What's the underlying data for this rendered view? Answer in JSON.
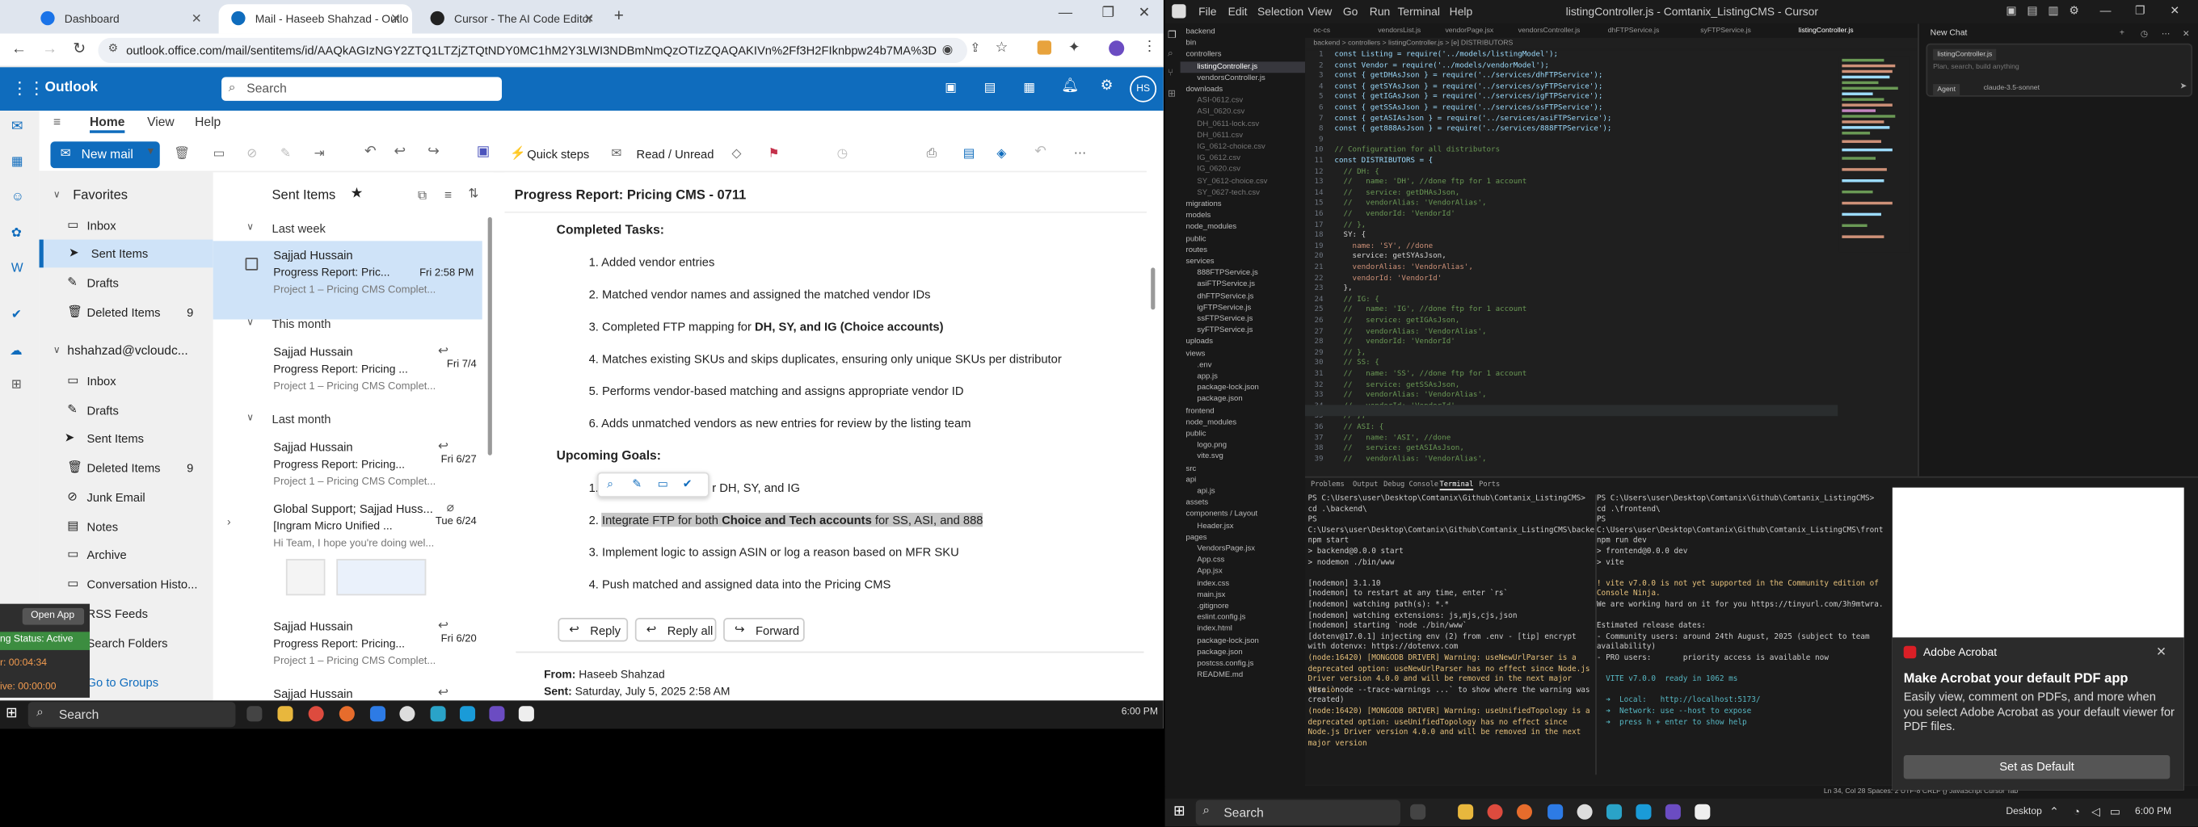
{
  "browser": {
    "tabs": [
      {
        "label": "Dashboard"
      },
      {
        "label": "Mail - Haseeb Shahzad - Outlo"
      },
      {
        "label": "Cursor - The AI Code Editor"
      }
    ],
    "url": "outlook.office.com/mail/sentitems/id/AAQkAGIzNGY2ZTQ1LTZjZTQtNDY0MC1hM2Y3LWI3NDBmNmQzOTIzZQAQAKIVn%2Ff3H2FIknbpw24b7MA%3D"
  },
  "outlook": {
    "app_name": "Outlook",
    "search_placeholder": "Search",
    "avatar": "HS",
    "ribbon_tabs": [
      "Home",
      "View",
      "Help"
    ],
    "new_mail": "New mail",
    "quick_steps": "Quick steps",
    "read_unread": "Read / Unread",
    "nav": {
      "favorites": "Favorites",
      "account": "hshahzad@vcloudc...",
      "inbox": "Inbox",
      "sent": "Sent Items",
      "drafts": "Drafts",
      "deleted": "Deleted Items",
      "deleted_count": "9",
      "junk": "Junk Email",
      "notes": "Notes",
      "archive": "Archive",
      "conversation": "Conversation Histo...",
      "rss": "RSS Feeds",
      "search_folders": "Search Folders",
      "go_groups": "Go to Groups",
      "inbox2": "Inbox",
      "drafts2": "Drafts",
      "sent2": "Sent Items",
      "deleted2": "Deleted Items",
      "deleted_count2": "9"
    },
    "list_title": "Sent Items",
    "groups": [
      "Last week",
      "This month",
      "Last month"
    ],
    "messages": [
      {
        "from": "Sajjad Hussain",
        "subject": "Progress Report: Pric...",
        "date": "Fri 2:58 PM",
        "preview": "Project 1 – Pricing CMS Complet..."
      },
      {
        "from": "Sajjad Hussain",
        "subject": "Progress Report: Pricing ...",
        "date": "Fri 7/4",
        "preview": "Project 1 – Pricing CMS Complet..."
      },
      {
        "from": "Sajjad Hussain",
        "subject": "Progress Report: Pricing...",
        "date": "Fri 6/27",
        "preview": "Project 1 – Pricing CMS Complet..."
      },
      {
        "from": "Global Support; Sajjad Huss...",
        "subject": "[Ingram Micro Unified ...",
        "date": "Tue 6/24",
        "preview": "Hi Team, I hope you're doing wel..."
      },
      {
        "from": "Sajjad Hussain",
        "subject": "Progress Report: Pricing...",
        "date": "Fri 6/20",
        "preview": "Project 1 – Pricing CMS Complet..."
      },
      {
        "from": "Sajjad Hussain",
        "subject": "",
        "date": "",
        "preview": ""
      }
    ],
    "reading": {
      "subject": "Progress Report: Pricing CMS - 0711",
      "completed_heading": "Completed Tasks:",
      "completed": [
        "1. Added vendor entries",
        "2. Matched vendor names and assigned the matched vendor IDs",
        "3. Completed FTP mapping for ",
        "4. Matches existing SKUs and skips duplicates, ensuring only unique SKUs per distributor",
        "5. Performs vendor-based matching and assigns appropriate vendor ID",
        "6. Adds unmatched vendors as new entries for review by the listing team"
      ],
      "ftp_bold": "DH, SY, and IG (Choice accounts)",
      "upcoming_heading": "Upcoming Goals:",
      "upcoming1": "1. In",
      "upcoming1_tail": "r DH, SY, and IG",
      "upcoming2_a": "2. ",
      "upcoming2_b": "Integrate FTP for both ",
      "upcoming2_c": "Choice and Tech accounts",
      "upcoming2_d": " for SS, ASI, and 888",
      "upcoming3": "3. Implement logic to assign ASIN or log a reason based on MFR SKU",
      "upcoming4": "4. Push matched and assigned data into the Pricing CMS",
      "reply": "Reply",
      "reply_all": "Reply all",
      "forward": "Forward",
      "from_label": "From: ",
      "from_value": "Haseeb Shahzad",
      "sent_label": "Sent: ",
      "sent_value": "Saturday, July 5, 2025 2:58 AM"
    },
    "overlay": {
      "open_app": "Open App",
      "status": "ng Status: Active",
      "time1": "r: 00:04:34",
      "time2": "ive: 00:00:00"
    }
  },
  "taskbar_left": {
    "search": "Search",
    "time": "6:00 PM"
  },
  "cursor": {
    "title": "listingController.js - Comtanix_ListingCMS - Cursor",
    "menu": [
      "File",
      "Edit",
      "Selection",
      "View",
      "Go",
      "Run",
      "Terminal",
      "Help"
    ],
    "breadcrumb": "backend > controllers > listingController.js > [e] DISTRIBUTORS",
    "tabs": [
      "oc-cs",
      "vendorsList.js",
      "vendorPage.jsx",
      "vendorsController.js",
      "dhFTPService.js",
      "syFTPService.js",
      "listingController.js"
    ],
    "tree": [
      "backend",
      "bin",
      "controllers",
      "listingController.js",
      "vendorsController.js",
      "downloads",
      "ASI-0612.csv",
      "ASI_0620.csv",
      "DH_0611-lock.csv",
      "DH_0611.csv",
      "IG_0612-choice.csv",
      "IG_0612.csv",
      "IG_0620.csv",
      "SY_0612-choice.csv",
      "SY_0627-tech.csv",
      "migrations",
      "models",
      "node_modules",
      "public",
      "routes",
      "services",
      "888FTPService.js",
      "asiFTPService.js",
      "dhFTPService.js",
      "igFTPService.js",
      "ssFTPService.js",
      "syFTPService.js",
      "uploads",
      "views",
      ".env",
      "app.js",
      "package-lock.json",
      "package.json",
      "frontend",
      "node_modules",
      "public",
      "logo.png",
      "vite.svg",
      "src",
      "api",
      "api.js",
      "assets",
      "components / Layout",
      "Header.jsx",
      "pages",
      "VendorsPage.jsx",
      "App.css",
      "App.jsx",
      "index.css",
      "main.jsx",
      ".gitignore",
      "eslint.config.js",
      "index.html",
      "package-lock.json",
      "package.json",
      "postcss.config.js",
      "README.md"
    ],
    "code": [
      "const Listing = require('../models/listingModel');",
      "const Vendor = require('../models/vendorModel');",
      "const { getDHAsJson } = require('../services/dhFTPService');",
      "const { getSYAsJson } = require('../services/syFTPService');",
      "const { getIGAsJson } = require('../services/igFTPService');",
      "const { getSSAsJson } = require('../services/ssFTPService');",
      "const { getASIAsJson } = require('../services/asiFTPService');",
      "const { get888AsJson } = require('../services/888FTPService');",
      "",
      "// Configuration for all distributors",
      "const DISTRIBUTORS = {",
      "  // DH: {",
      "  //   name: 'DH', //done ftp for 1 account",
      "  //   service: getDHAsJson,",
      "  //   vendorAlias: 'VendorAlias',",
      "  //   vendorId: 'VendorId'",
      "  // },",
      "  SY: {",
      "    name: 'SY', //done",
      "    service: getSYAsJson,",
      "    vendorAlias: 'VendorAlias',",
      "    vendorId: 'VendorId'",
      "  },",
      "  // IG: {",
      "  //   name: 'IG', //done ftp for 1 account",
      "  //   service: getIGAsJson,",
      "  //   vendorAlias: 'VendorAlias',",
      "  //   vendorId: 'VendorId'",
      "  // },",
      "  // SS: {",
      "  //   name: 'SS', //done ftp for 1 account",
      "  //   service: getSSAsJson,",
      "  //   vendorAlias: 'VendorAlias',",
      "  //   vendorId: 'VendorId'",
      "  // },",
      "  // ASI: {",
      "  //   name: 'ASI', //done",
      "  //   service: getASIAsJson,",
      "  //   vendorAlias: 'VendorAlias',"
    ],
    "chat": {
      "title": "New Chat",
      "file_chip": "listingController.js",
      "placeholder": "Plan, search, build anything",
      "agent": "Agent",
      "model": "claude-3.5-sonnet"
    },
    "panel_tabs": [
      "Problems",
      "Output",
      "Debug Console",
      "Terminal",
      "Ports"
    ],
    "term_left": [
      "PS C:\\Users\\user\\Desktop\\Comtanix\\Github\\Comtanix_ListingCMS> cd .\\backend\\",
      "PS C:\\Users\\user\\Desktop\\Comtanix\\Github\\Comtanix_ListingCMS\\backend> npm start",
      "",
      "> backend@0.0.0 start",
      "> nodemon ./bin/www",
      "",
      "[nodemon] 3.1.10",
      "[nodemon] to restart at any time, enter `rs`",
      "[nodemon] watching path(s): *.*",
      "[nodemon] watching extensions: js,mjs,cjs,json",
      "[nodemon] starting `node ./bin/www`",
      "[dotenv@17.0.1] injecting env (2) from .env - [tip] encrypt with dotenvx: https://dotenvx.com",
      "(node:16420) [MONGODB DRIVER] Warning: useNewUrlParser is a deprecated option: useNewUrlParser has no effect since Node.js Driver version 4.0.0 and will be removed in the next major version",
      "(Use `node --trace-warnings ...` to show where the warning was created)",
      "(node:16420) [MONGODB DRIVER] Warning: useUnifiedTopology is a deprecated option: useUnifiedTopology has no effect since Node.js Driver version 4.0.0 and will be removed in the next major version"
    ],
    "term_right": [
      "PS C:\\Users\\user\\Desktop\\Comtanix\\Github\\Comtanix_ListingCMS> cd .\\frontend\\",
      "PS C:\\Users\\user\\Desktop\\Comtanix\\Github\\Comtanix_ListingCMS\\frontend> npm run dev",
      "",
      "> frontend@0.0.0 dev",
      "> vite",
      "",
      "! vite v7.0.0 is not yet supported in the Community edition of Console Ninja.",
      "We are working hard on it for you https://tinyurl.com/3h9mtwra.",
      "",
      "Estimated release dates:",
      "- Community users: around 24th August, 2025 (subject to team availability)",
      "- PRO users:       priority access is available now",
      "",
      "  VITE v7.0.0  ready in 1062 ms",
      "",
      "  ➜  Local:   http://localhost:5173/",
      "  ➜  Network: use --host to expose",
      "  ➜  press h + enter to show help"
    ],
    "status": "Ln 34, Col 28  Spaces: 2  UTF-8  CRLF  {} JavaScript  Cursor Tab"
  },
  "acrobat": {
    "brand": "Adobe Acrobat",
    "heading": "Make Acrobat your default PDF app",
    "body": "Easily view, comment on PDFs, and more when you select Adobe Acrobat as your default viewer for PDF files.",
    "button": "Set as Default"
  },
  "taskbar_right": {
    "search": "Search",
    "desktop": "Desktop",
    "time": "6:00 PM"
  }
}
